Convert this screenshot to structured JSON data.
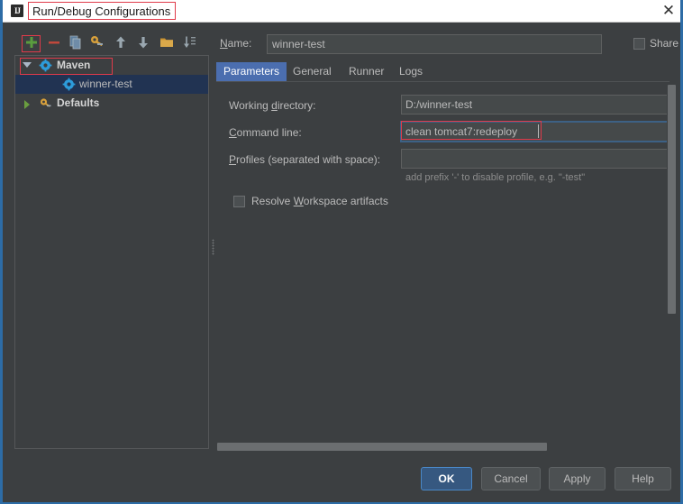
{
  "window": {
    "title": "Run/Debug Configurations",
    "app_icon": "intellij-idea-icon",
    "close_icon": "close-icon"
  },
  "toolbar": {
    "buttons": [
      {
        "name": "add-configuration-button",
        "icon": "plus-icon",
        "tooltip": "Add New Configuration"
      },
      {
        "name": "remove-configuration-button",
        "icon": "minus-icon",
        "tooltip": "Remove Configuration"
      },
      {
        "name": "copy-configuration-button",
        "icon": "copy-icon",
        "tooltip": "Copy Configuration"
      },
      {
        "name": "edit-defaults-button",
        "icon": "wrench-icon",
        "tooltip": "Edit defaults"
      },
      {
        "name": "move-up-button",
        "icon": "arrow-up-icon",
        "tooltip": "Move Up"
      },
      {
        "name": "move-down-button",
        "icon": "arrow-down-icon",
        "tooltip": "Move Down"
      },
      {
        "name": "create-folder-button",
        "icon": "folder-icon",
        "tooltip": "Create New Folder"
      },
      {
        "name": "sort-configurations-button",
        "icon": "sort-icon",
        "tooltip": "Sort Configurations"
      }
    ]
  },
  "tree": {
    "items": [
      {
        "label": "Maven",
        "icon": "maven-gear-icon",
        "expanded": true,
        "bold": true,
        "selected": false,
        "level": 0
      },
      {
        "label": "winner-test",
        "icon": "maven-gear-icon",
        "expanded": null,
        "bold": false,
        "selected": true,
        "level": 1
      },
      {
        "label": "Defaults",
        "icon": "defaults-icon",
        "expanded": false,
        "bold": true,
        "selected": false,
        "level": 0
      }
    ]
  },
  "name_row": {
    "label": "Name:",
    "label_mnemonic": "N",
    "value": "winner-test",
    "placeholder": "",
    "share_label": "Share",
    "share_label_visible": "Sha",
    "share_checked": false
  },
  "tabs": [
    {
      "label": "Parameters",
      "active": true
    },
    {
      "label": "General",
      "active": false
    },
    {
      "label": "Runner",
      "active": false
    },
    {
      "label": "Logs",
      "active": false
    }
  ],
  "parameters": {
    "working_directory": {
      "label": "Working directory:",
      "label_mnemonic": "d",
      "value": "D:/winner-test",
      "placeholder": ""
    },
    "command_line": {
      "label": "Command line:",
      "label_mnemonic": "C",
      "value": "clean tomcat7:redeploy",
      "placeholder": "",
      "focused": true,
      "highlighted": true
    },
    "profiles": {
      "label": "Profiles (separated with space):",
      "label_mnemonic": "P",
      "value": "",
      "placeholder": "",
      "hint": "add prefix '-' to disable profile, e.g. \"-test\""
    },
    "resolve_workspace": {
      "label": "Resolve Workspace artifacts",
      "label_mnemonic": "W",
      "checked": false
    }
  },
  "buttons": [
    {
      "label": "OK",
      "primary": true,
      "name": "ok-button"
    },
    {
      "label": "Cancel",
      "primary": false,
      "name": "cancel-button"
    },
    {
      "label": "Apply",
      "primary": false,
      "name": "apply-button"
    },
    {
      "label": "Help",
      "primary": false,
      "name": "help-button"
    }
  ],
  "colors": {
    "window_border": "#2d6ca6",
    "background": "#3c3f41",
    "field_background": "#45494a",
    "text": "#bbbbbb",
    "tab_active": "#4b6eaf",
    "tree_selected": "#213352",
    "annotation_red": "#e03a4a",
    "primary_button": "#365880",
    "add_icon_green": "#5a9c3e",
    "remove_icon_red": "#c0483c"
  }
}
